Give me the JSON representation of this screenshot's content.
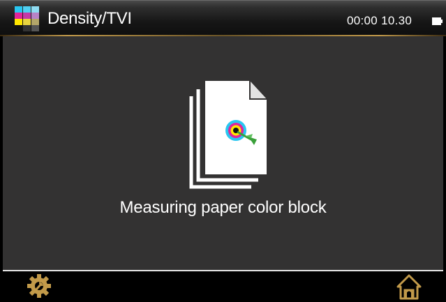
{
  "header": {
    "title": "Density/TVI",
    "clock": "00:00 10.30",
    "logo_icon": "cmyk-color-grid-icon",
    "battery_icon": "battery-icon"
  },
  "main": {
    "illustration_icon": "stacked-documents-with-target-icon",
    "status_message": "Measuring paper color block"
  },
  "footer": {
    "settings_icon": "settings-gear-icon",
    "home_icon": "home-icon"
  },
  "colors": {
    "cyan": "#29c6f0",
    "magenta": "#e0249a",
    "yellow": "#ffe600",
    "black": "#111111",
    "accent_gold": "#c29a4a",
    "background": "#333232"
  }
}
